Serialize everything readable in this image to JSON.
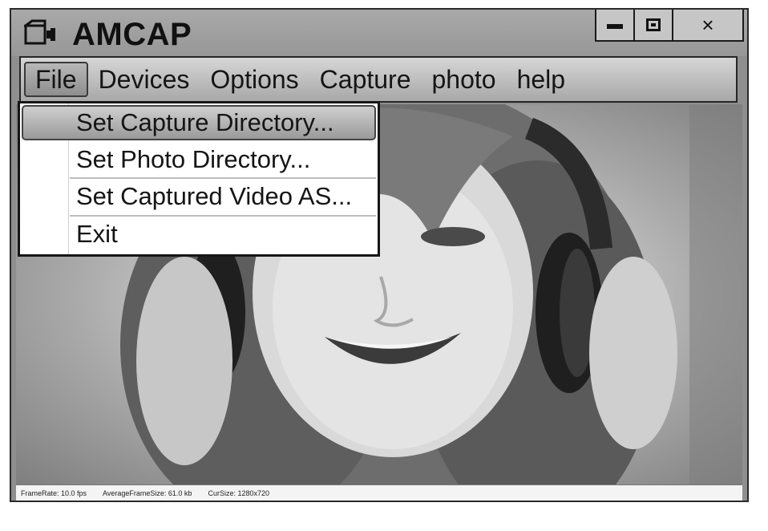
{
  "window": {
    "title": "AMCAP",
    "app_icon": "camera-icon",
    "controls": {
      "minimize_icon": "minimize-icon",
      "maximize_icon": "maximize-icon",
      "close_glyph": "×"
    }
  },
  "menubar": {
    "items": [
      {
        "label": "File",
        "active": true
      },
      {
        "label": "Devices"
      },
      {
        "label": "Options"
      },
      {
        "label": "Capture"
      },
      {
        "label": "photo"
      },
      {
        "label": "help"
      }
    ]
  },
  "file_menu": {
    "items": [
      {
        "label": "Set Capture Directory...",
        "highlighted": true
      },
      {
        "label": "Set Photo Directory..."
      },
      {
        "label": "Set Captured Video AS..."
      },
      {
        "label": "Exit"
      }
    ]
  },
  "preview": {
    "content": "live camera preview"
  },
  "statusbar": {
    "frame_rate": "FrameRate: 10.0 fps",
    "avg_frame_size": "AverageFrameSize: 61.0 kb",
    "cur_size": "CurSize: 1280x720"
  },
  "colors": {
    "titlebar": "#a0a0a0",
    "menubar": "#c0c0c0",
    "menu_highlight": "#b0b0b0",
    "border": "#1b1b1b"
  }
}
